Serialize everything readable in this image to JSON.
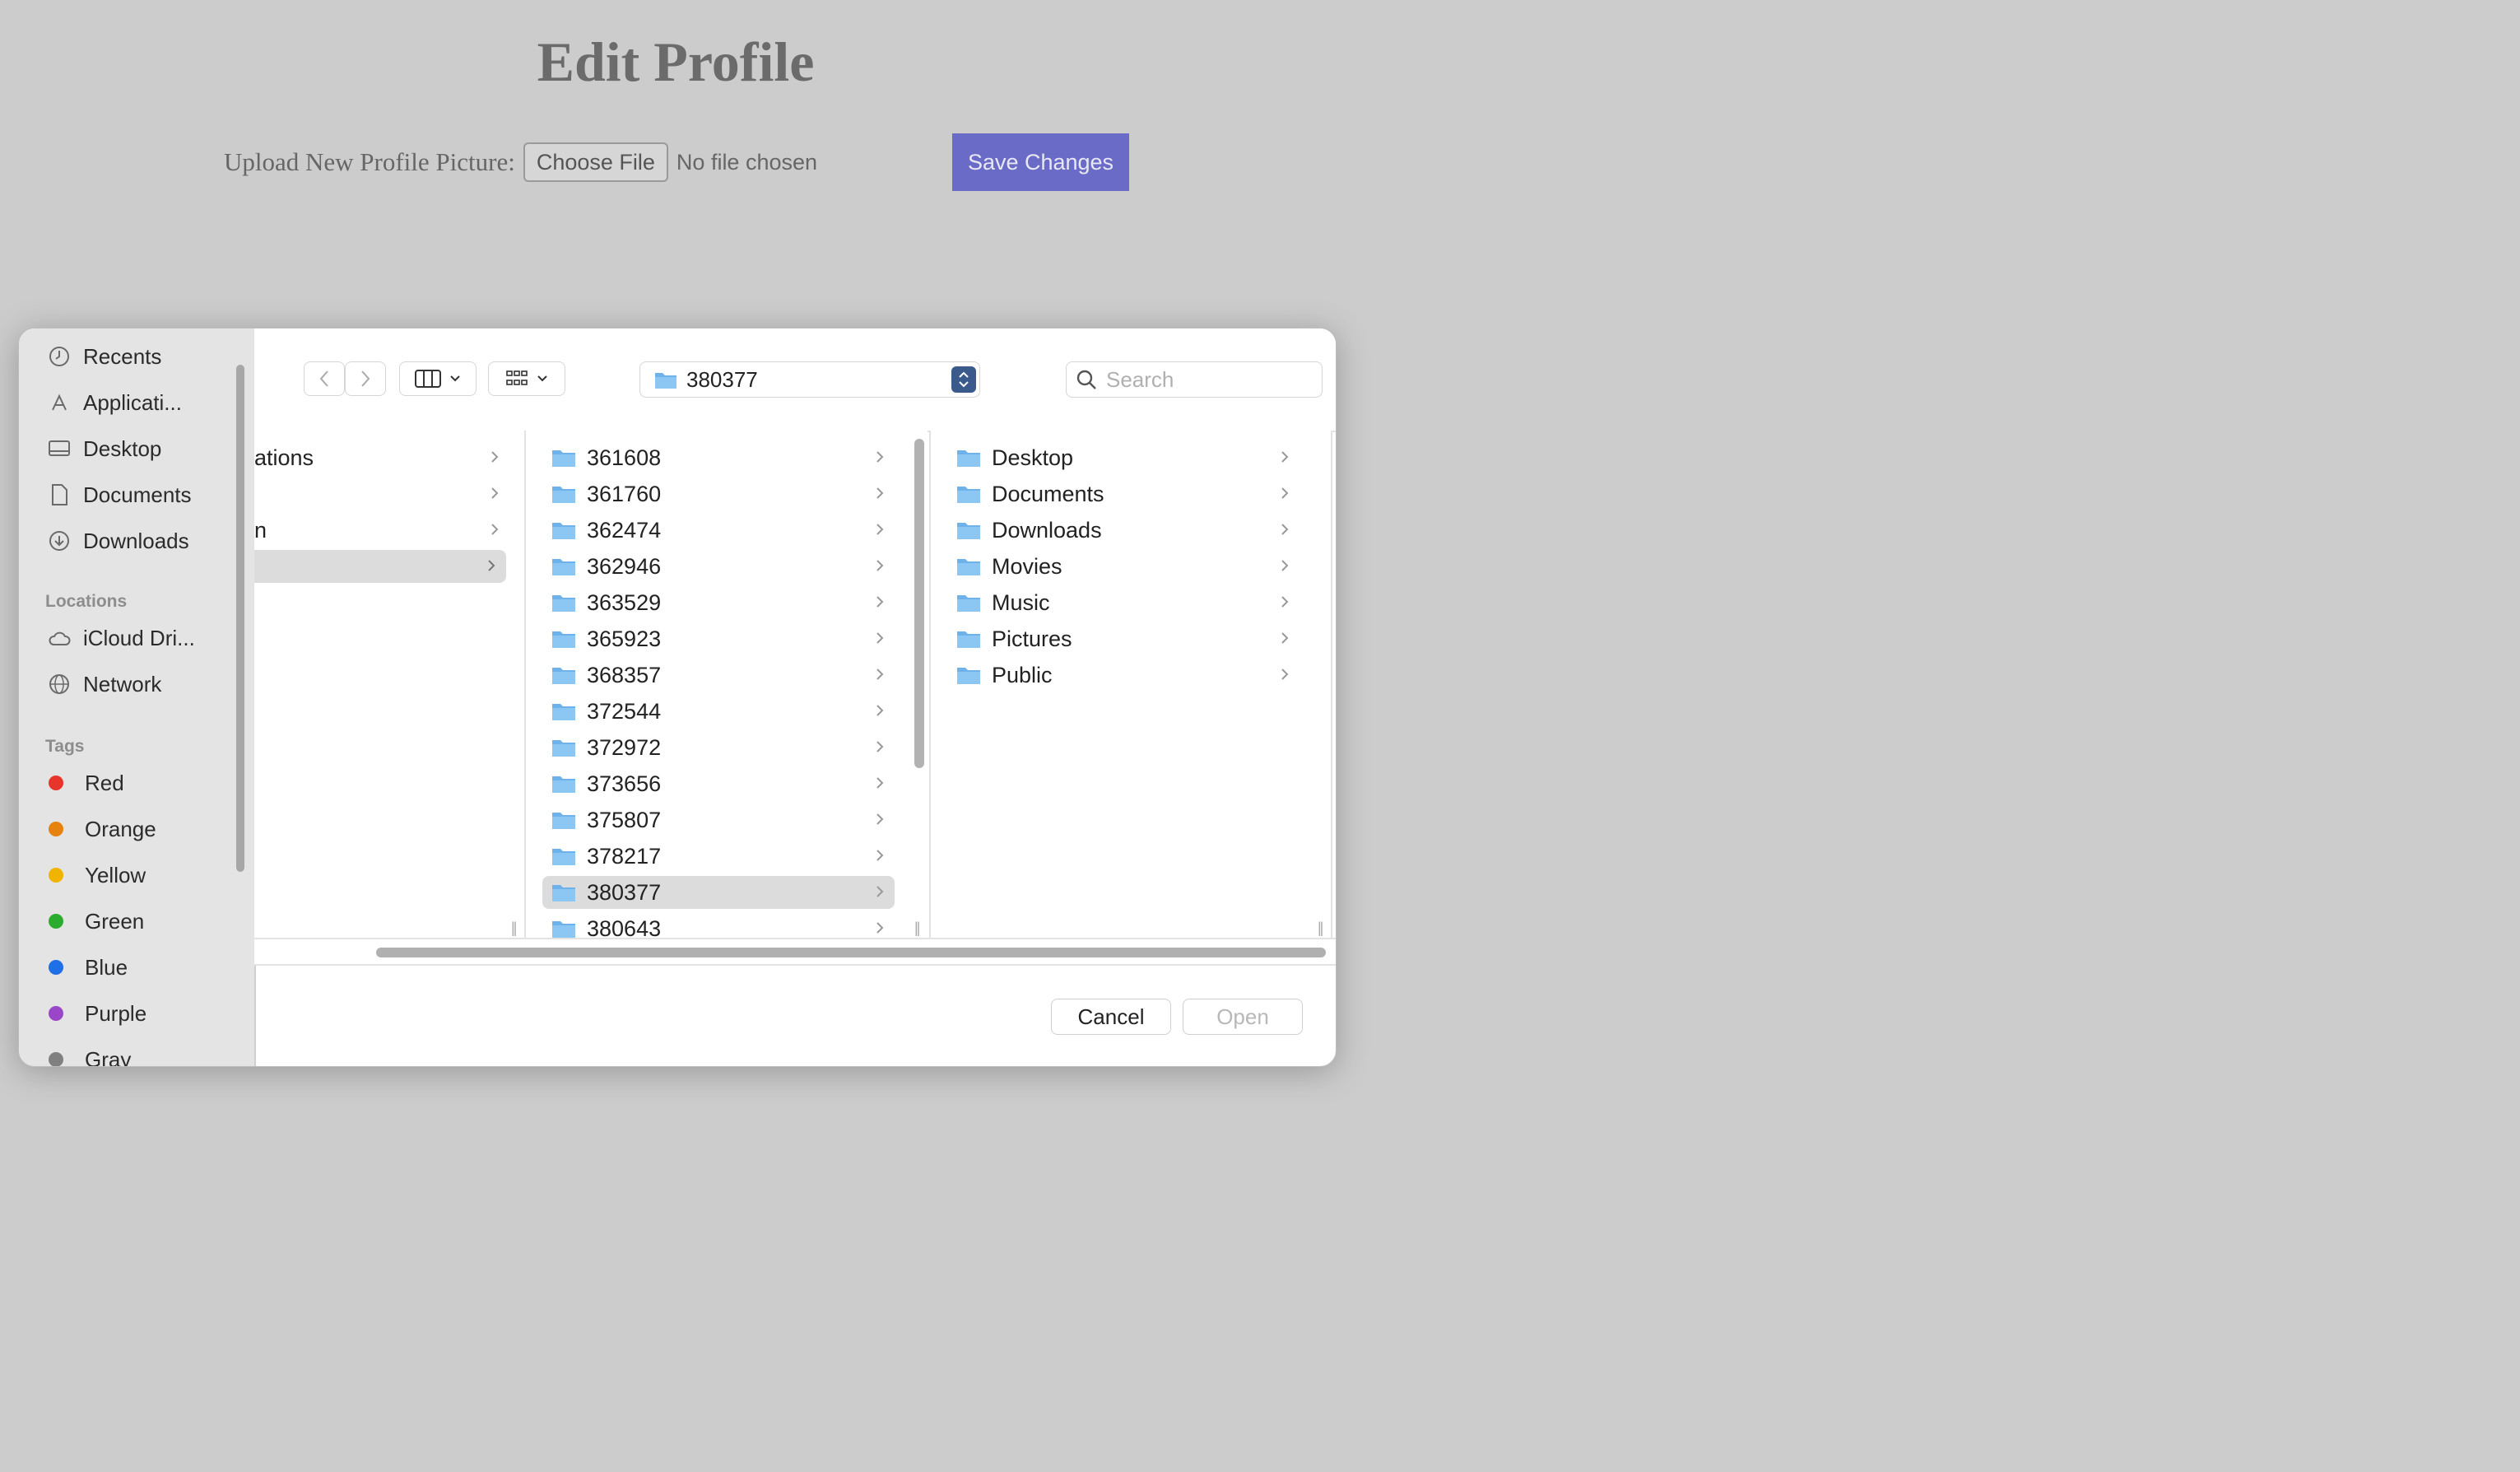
{
  "page": {
    "title": "Edit Profile",
    "upload_label": "Upload New Profile Picture:",
    "choose_file": "Choose File",
    "no_file": "No file chosen",
    "save": "Save Changes"
  },
  "dialog": {
    "sidebar": {
      "favorites": [
        {
          "label": "Recents",
          "icon": "clock-icon"
        },
        {
          "label": "Applicati...",
          "icon": "applications-icon"
        },
        {
          "label": "Desktop",
          "icon": "desktop-icon"
        },
        {
          "label": "Documents",
          "icon": "document-icon"
        },
        {
          "label": "Downloads",
          "icon": "download-icon"
        }
      ],
      "locations_heading": "Locations",
      "locations": [
        {
          "label": "iCloud Dri...",
          "icon": "cloud-icon"
        },
        {
          "label": "Network",
          "icon": "globe-icon"
        }
      ],
      "tags_heading": "Tags",
      "tags": [
        {
          "label": "Red",
          "color": "#e8352c"
        },
        {
          "label": "Orange",
          "color": "#e8820e"
        },
        {
          "label": "Yellow",
          "color": "#f0b400"
        },
        {
          "label": "Green",
          "color": "#2aad2e"
        },
        {
          "label": "Blue",
          "color": "#1f6fe6"
        },
        {
          "label": "Purple",
          "color": "#9a46c8"
        },
        {
          "label": "Gray",
          "color": "#808080"
        }
      ]
    },
    "toolbar": {
      "current_folder": "380377",
      "search_placeholder": "Search"
    },
    "column1": [
      "ations",
      "",
      "n",
      ""
    ],
    "column2": [
      "361608",
      "361760",
      "362474",
      "362946",
      "363529",
      "365923",
      "368357",
      "372544",
      "372972",
      "373656",
      "375807",
      "378217",
      "380377",
      "380643"
    ],
    "column2_selected": "380377",
    "column3": [
      "Desktop",
      "Documents",
      "Downloads",
      "Movies",
      "Music",
      "Pictures",
      "Public"
    ],
    "cancel": "Cancel",
    "open": "Open"
  }
}
